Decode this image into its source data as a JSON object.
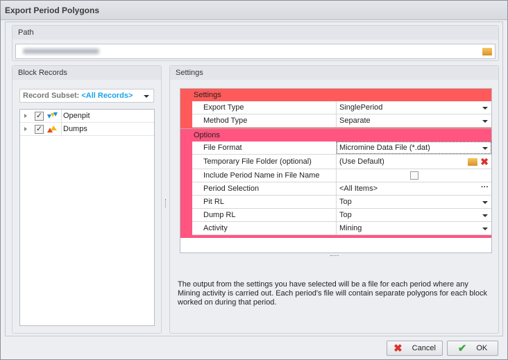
{
  "window": {
    "title": "Export Period Polygons"
  },
  "path": {
    "label": "Path"
  },
  "block_records": {
    "label": "Block Records",
    "subset_label": "Record Subset:",
    "subset_value": "<All Records>",
    "items": [
      {
        "label": "Openpit",
        "checked": true
      },
      {
        "label": "Dumps",
        "checked": true
      }
    ]
  },
  "settings": {
    "label": "Settings",
    "categories": [
      {
        "name": "Settings",
        "color": "#ff5a5a",
        "rows": [
          {
            "name": "Export Type",
            "value": "SinglePeriod"
          },
          {
            "name": "Method Type",
            "value": "Separate"
          }
        ]
      },
      {
        "name": "Options",
        "color": "#ff5580",
        "rows": [
          {
            "name": "File Format",
            "value": "Micromine Data File (*.dat)"
          },
          {
            "name": "Temporary File Folder (optional)",
            "value": "(Use Default)"
          },
          {
            "name": "Include Period Name in File Name",
            "value": ""
          },
          {
            "name": "Period Selection",
            "value": "<All Items>"
          },
          {
            "name": "Pit RL",
            "value": "Top"
          },
          {
            "name": "Dump RL",
            "value": "Top"
          },
          {
            "name": "Activity",
            "value": "Mining"
          }
        ]
      }
    ]
  },
  "description": "The output from the settings you have selected will be a file for each period where any Mining activity is carried out. Each period's file will contain separate polygons for each block worked on during that period.",
  "buttons": {
    "cancel": "Cancel",
    "ok": "OK"
  }
}
